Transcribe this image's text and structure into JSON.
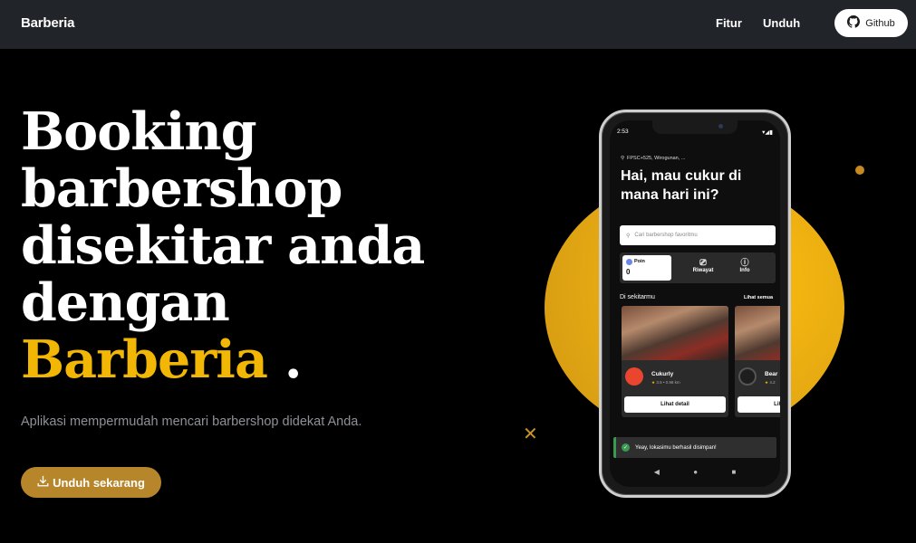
{
  "navbar": {
    "brand": "Barberia",
    "links": [
      {
        "label": "Fitur"
      },
      {
        "label": "Unduh"
      }
    ],
    "github_label": "Github",
    "background": "#212429"
  },
  "hero": {
    "title_lines": [
      "Booking",
      "barbershop",
      "disekitar anda",
      "dengan"
    ],
    "title_accent": "Barberia",
    "title_end": ".",
    "subtitle": "Aplikasi mempermudah mencari barbershop didekat Anda.",
    "cta_label": "Unduh sekarang",
    "accent_color": "#f2b705",
    "cta_color": "#b8862a"
  },
  "phone": {
    "status_time": "2:53",
    "status_icons": "▾◢▮",
    "location": "FPSC+525, Wirogunan, ...",
    "greeting": "Hai, mau cukur di mana hari ini?",
    "search_placeholder": "Cari barbershop favoritmu",
    "poin_label": "Poin",
    "poin_value": "0",
    "quick_items": [
      {
        "label": "Riwayat",
        "icon": "history-icon"
      },
      {
        "label": "Info",
        "icon": "info-icon"
      }
    ],
    "section_title": "Di sekitarmu",
    "section_link": "Lihat semua",
    "shops": [
      {
        "name": "Cukurly",
        "rating": "3.5",
        "distance": "0.98 km",
        "button": "Lihat detail"
      },
      {
        "name": "Bear",
        "rating": "4.2",
        "distance": "",
        "button": "Lihat detail"
      }
    ],
    "toast": "Yeay, lokasimu berhasil disimpan!",
    "nav_icons": [
      "◀",
      "●",
      "■"
    ]
  }
}
